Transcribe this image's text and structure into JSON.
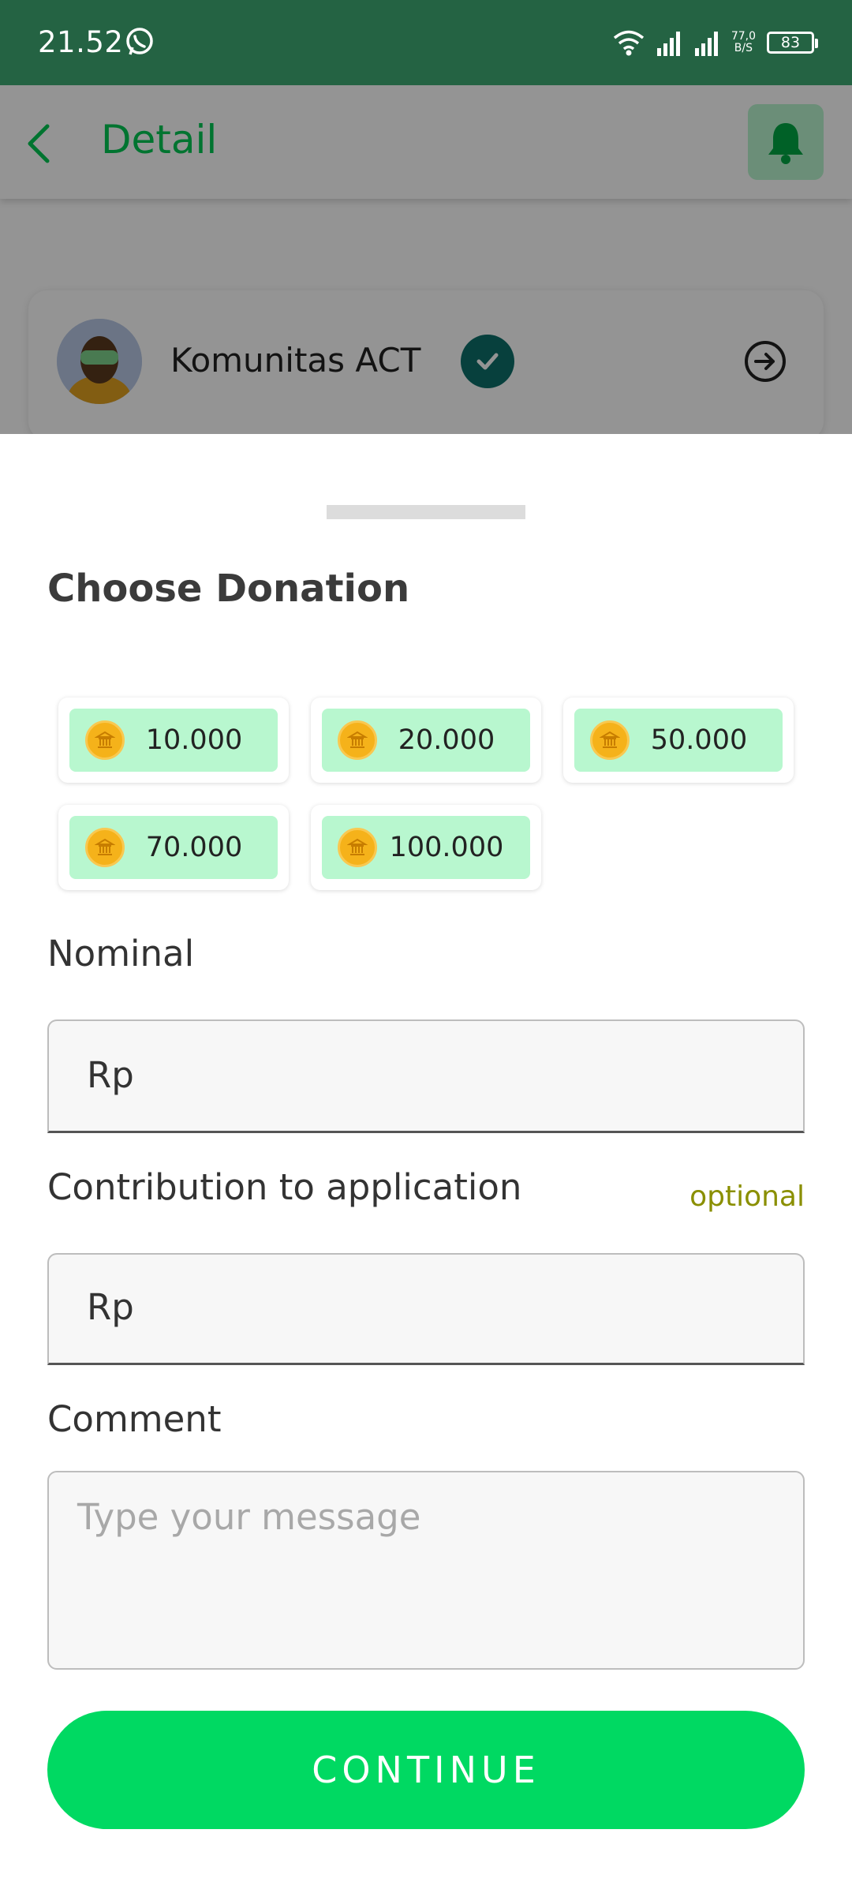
{
  "status_bar": {
    "time": "21.52",
    "net_speed_value": "77,0",
    "net_speed_unit": "B/S",
    "battery": "83",
    "icons": [
      "whatsapp-icon",
      "wifi-icon",
      "signal-icon",
      "signal-icon",
      "battery-icon"
    ]
  },
  "app_bar": {
    "title": "Detail",
    "back_icon": "chevron-left-icon",
    "action_icon": "bell-icon"
  },
  "org_card": {
    "name": "Komunitas ACT",
    "verified_icon": "check-badge-icon",
    "go_icon": "arrow-right-circle-icon"
  },
  "sheet": {
    "title": "Choose Donation",
    "amount_options": [
      "10.000",
      "20.000",
      "50.000",
      "70.000",
      "100.000"
    ],
    "nominal": {
      "label": "Nominal",
      "prefix": "Rp",
      "value": ""
    },
    "contribution": {
      "label": "Contribution to application",
      "hint": "optional",
      "prefix": "Rp",
      "value": ""
    },
    "comment": {
      "label": "Comment",
      "placeholder": "Type your message"
    },
    "continue_label": "CONTINUE"
  },
  "colors": {
    "status_bar": "#246343",
    "accent_green": "#00d962",
    "chip_fill": "#b8f7cf",
    "optional_text": "#8a8f00",
    "verified_badge": "#0d6f6a"
  }
}
